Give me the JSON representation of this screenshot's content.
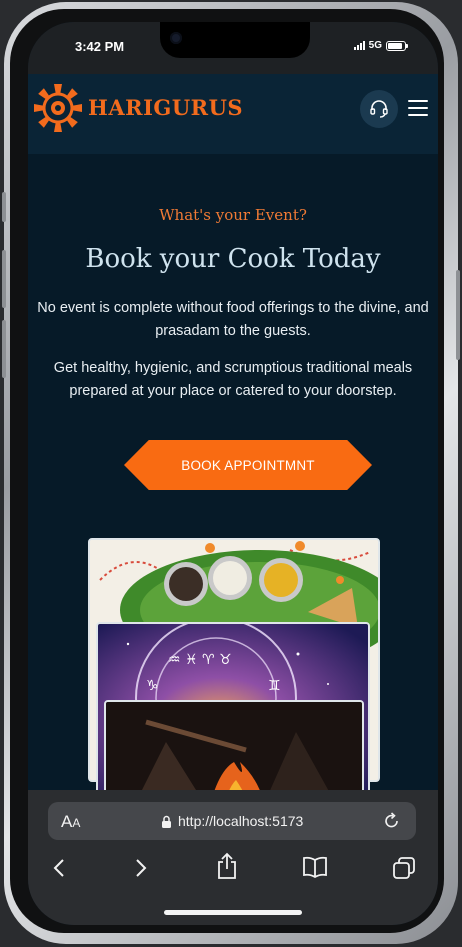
{
  "status": {
    "time": "3:42 PM",
    "network": "5G"
  },
  "nav": {
    "brand": "HARIGURUS",
    "support_icon": "headset-icon",
    "menu_icon": "hamburger-menu-icon"
  },
  "hero": {
    "eyebrow": "What's your Event?",
    "headline": "Book your Cook Today",
    "para1": "No event is complete without food offerings to the divine, and prasadam to the guests.",
    "para2": "Get healthy, hygienic, and scrumptious traditional meals prepared at your place or catered to your doorstep.",
    "cta_label": "BOOK APPOINTMNT"
  },
  "browser": {
    "aa_label": "A",
    "aa_small": "A",
    "url": "http://localhost:5173",
    "icons": [
      "lock-icon",
      "reload-icon",
      "back-icon",
      "forward-icon",
      "share-icon",
      "bookmarks-icon",
      "tabs-icon"
    ]
  },
  "colors": {
    "accent": "#f96b12",
    "page_bg": "#061a28",
    "nav_bg": "#0a2436",
    "brand": "#f26b1d"
  }
}
